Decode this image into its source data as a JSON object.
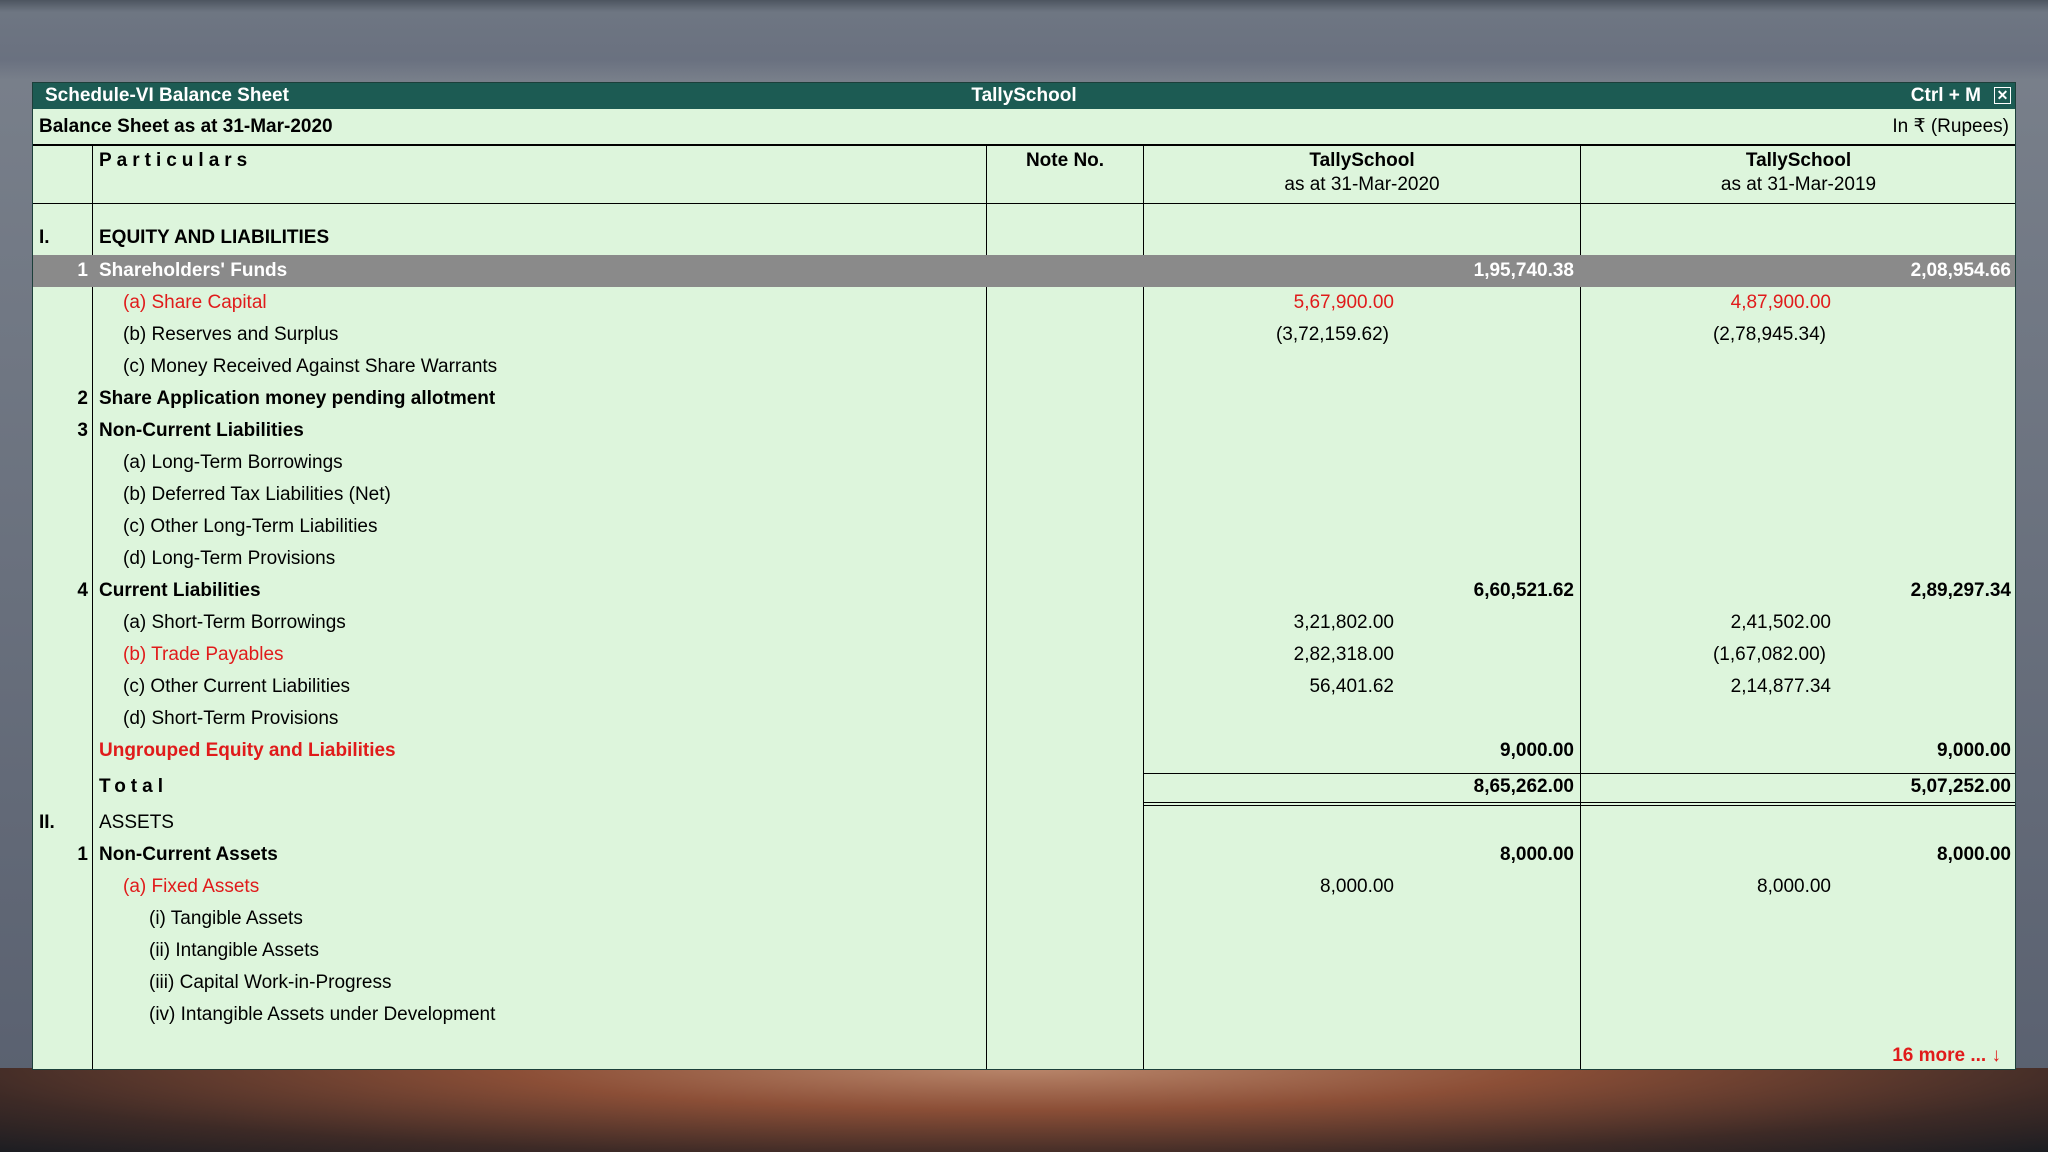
{
  "window": {
    "title_left": "Schedule-VI Balance Sheet",
    "title_center": "TallySchool",
    "title_right": "Ctrl + M",
    "close_glyph": "✕"
  },
  "subheader": {
    "left": "Balance Sheet as at 31-Mar-2020",
    "right": "In ₹ (Rupees)"
  },
  "columns": {
    "particulars": "Particulars",
    "note_no": "Note No.",
    "col1_company": "TallySchool",
    "col1_date": "as at 31-Mar-2020",
    "col2_company": "TallySchool",
    "col2_date": "as at 31-Mar-2019"
  },
  "rows": {
    "equity_heading": {
      "roman": "I.",
      "label": "EQUITY AND LIABILITIES"
    },
    "shareholders": {
      "num": "1",
      "label": "Shareholders' Funds",
      "total1": "1,95,740.38",
      "total2": "2,08,954.66"
    },
    "share_capital": {
      "label": "(a) Share Capital",
      "v1": "5,67,900.00",
      "v2": "4,87,900.00"
    },
    "reserves": {
      "label": "(b) Reserves and Surplus",
      "v1": "(3,72,159.62)",
      "v2": "(2,78,945.34)"
    },
    "money_received": {
      "label": "(c) Money Received Against Share Warrants"
    },
    "share_application": {
      "num": "2",
      "label": "Share Application money pending allotment"
    },
    "noncurrent_liab": {
      "num": "3",
      "label": "Non-Current Liabilities"
    },
    "lt_borrowings": {
      "label": "(a) Long-Term Borrowings"
    },
    "deferred_tax": {
      "label": "(b) Deferred Tax Liabilities (Net)"
    },
    "other_lt_liab": {
      "label": "(c) Other Long-Term Liabilities"
    },
    "lt_provisions": {
      "label": "(d) Long-Term Provisions"
    },
    "current_liab": {
      "num": "4",
      "label": "Current Liabilities",
      "total1": "6,60,521.62",
      "total2": "2,89,297.34"
    },
    "st_borrowings": {
      "label": "(a) Short-Term Borrowings",
      "v1": "3,21,802.00",
      "v2": "2,41,502.00"
    },
    "trade_payables": {
      "label": "(b) Trade Payables",
      "v1": "2,82,318.00",
      "v2": "(1,67,082.00)"
    },
    "other_current_liab": {
      "label": "(c) Other Current Liabilities",
      "v1": "56,401.62",
      "v2": "2,14,877.34"
    },
    "st_provisions": {
      "label": "(d) Short-Term Provisions"
    },
    "ungrouped": {
      "label": "Ungrouped Equity and Liabilities",
      "total1": "9,000.00",
      "total2": "9,000.00"
    },
    "total": {
      "label": "Total",
      "total1": "8,65,262.00",
      "total2": "5,07,252.00"
    },
    "assets_heading": {
      "roman": "II.",
      "label": "ASSETS"
    },
    "noncurrent_assets": {
      "num": "1",
      "label": "Non-Current Assets",
      "total1": "8,000.00",
      "total2": "8,000.00"
    },
    "fixed_assets": {
      "label": "(a) Fixed Assets",
      "v1": "8,000.00",
      "v2": "8,000.00"
    },
    "tangible": {
      "label": "(i) Tangible Assets"
    },
    "intangible": {
      "label": "(ii) Intangible Assets"
    },
    "cwip": {
      "label": "(iii) Capital Work-in-Progress"
    },
    "intangible_dev": {
      "label": "(iv) Intangible Assets under Development"
    }
  },
  "more": "16 more ... ↓"
}
